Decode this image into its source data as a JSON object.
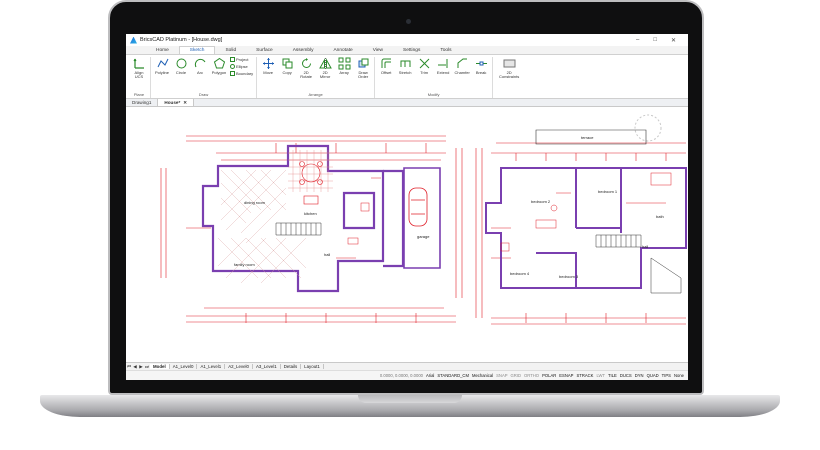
{
  "app": {
    "title": "BricsCAD Platinum - [House.dwg]",
    "window_controls": [
      "–",
      "□",
      "✕"
    ]
  },
  "ribbon_tabs": [
    "Home",
    "Sketch",
    "Solid",
    "Surface",
    "Assembly",
    "Annotate",
    "View",
    "Settings",
    "Tools"
  ],
  "active_ribbon_tab": "Sketch",
  "ribbon_groups": [
    {
      "label": "Plane",
      "tools": [
        {
          "label": "Align UCS",
          "icon": "align-ucs-icon"
        }
      ]
    },
    {
      "label": "Draw",
      "tools": [
        {
          "label": "Polyline",
          "icon": "polyline-icon"
        },
        {
          "label": "Circle",
          "icon": "circle-icon"
        },
        {
          "label": "Arc",
          "icon": "arc-icon"
        },
        {
          "label": "Polygon",
          "icon": "polygon-icon"
        }
      ],
      "small": [
        "Project",
        "Ellipse",
        "Boundary"
      ]
    },
    {
      "label": "Arrange",
      "tools": [
        {
          "label": "Move",
          "icon": "move-icon"
        },
        {
          "label": "Copy",
          "icon": "copy-icon"
        },
        {
          "label": "2D Rotate",
          "icon": "rotate-icon"
        },
        {
          "label": "2D Mirror",
          "icon": "mirror-icon"
        },
        {
          "label": "Array",
          "icon": "array-icon"
        },
        {
          "label": "Draw Order",
          "icon": "draw-order-icon"
        }
      ]
    },
    {
      "label": "Modify",
      "tools": [
        {
          "label": "Offset",
          "icon": "offset-icon"
        },
        {
          "label": "Stretch",
          "icon": "stretch-icon"
        },
        {
          "label": "Trim",
          "icon": "trim-icon"
        },
        {
          "label": "Extend",
          "icon": "extend-icon"
        },
        {
          "label": "Chamfer",
          "icon": "chamfer-icon"
        },
        {
          "label": "Break",
          "icon": "break-icon"
        }
      ]
    },
    {
      "label": "",
      "tools": [
        {
          "label": "2D Constraints",
          "icon": "constraints-icon"
        }
      ]
    }
  ],
  "doc_tabs": [
    {
      "label": "Drawing1",
      "active": false
    },
    {
      "label": "House*",
      "active": true
    }
  ],
  "drawing_labels": {
    "dining_room": "dining room",
    "kitchen": "kitchen",
    "family_room": "family room",
    "hall": "hall",
    "garage": "garage",
    "terrace": "terrace",
    "bedroom2": "bedroom 2",
    "bedroom1": "bedroom 1",
    "bedroom3": "bedroom 3",
    "bedroom4": "bedroom 4",
    "bath": "bath",
    "hall2": "hall"
  },
  "layout_tabs": [
    "Model",
    "A1_Level0",
    "A1_Level1",
    "A2_Level0",
    "A3_Level1",
    "Details",
    "Layout1"
  ],
  "active_layout_tab": "Model",
  "statusbar": {
    "coords": "0.0000, 0.0000, 0.0000",
    "items": [
      {
        "label": "Arial",
        "on": true
      },
      {
        "label": "STANDARD_CM",
        "on": true
      },
      {
        "label": "Mechanical",
        "on": true
      },
      {
        "label": "SNAP",
        "on": false
      },
      {
        "label": "GRID",
        "on": false
      },
      {
        "label": "ORTHO",
        "on": false
      },
      {
        "label": "POLAR",
        "on": true
      },
      {
        "label": "ESNAP",
        "on": true
      },
      {
        "label": "STRACK",
        "on": true
      },
      {
        "label": "LWT",
        "on": false
      },
      {
        "label": "TILE",
        "on": true
      },
      {
        "label": "DUCS",
        "on": true
      },
      {
        "label": "DYN",
        "on": true
      },
      {
        "label": "QUAD",
        "on": true
      },
      {
        "label": "TIPS",
        "on": true
      },
      {
        "label": "None",
        "on": true
      }
    ]
  },
  "colors": {
    "wall": "#7a3fb0",
    "dimension": "#e0202a",
    "linework": "#202020",
    "accent": "#1f5fb4"
  }
}
